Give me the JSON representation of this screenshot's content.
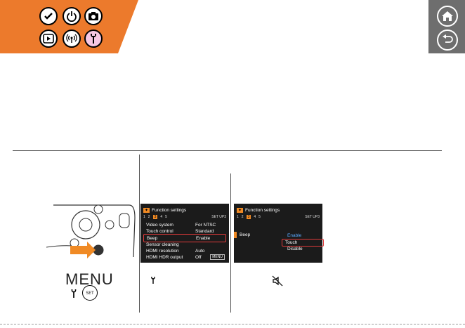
{
  "colors": {
    "accent": "#ec7a2c",
    "nav_gray": "#6e6e6e",
    "highlight_red": "#e03a3a"
  },
  "header": {
    "icons": [
      "check-icon",
      "power-icon",
      "camera-icon",
      "play-icon",
      "wireless-icon",
      "wrench-icon"
    ],
    "nav": [
      "home-icon",
      "back-icon"
    ]
  },
  "screen1": {
    "title": "Function settings",
    "tabs": [
      "1",
      "2",
      "3",
      "4",
      "5"
    ],
    "active_tab": "3",
    "right_label": "SET UP3",
    "rows": [
      {
        "label": "Video system",
        "value": "For NTSC"
      },
      {
        "label": "Touch control",
        "value": "Standard"
      },
      {
        "label": "Beep",
        "value": "Enable"
      },
      {
        "label": "Sensor cleaning",
        "value": ""
      },
      {
        "label": "HDMI resolution",
        "value": "Auto"
      },
      {
        "label": "HDMI HDR output",
        "value": "Off"
      }
    ],
    "menu_button": "MENU"
  },
  "screen2": {
    "title": "Function settings",
    "tabs": [
      "1",
      "2",
      "3",
      "4",
      "5"
    ],
    "active_tab": "3",
    "right_label": "SET UP3",
    "beep_label": "Beep",
    "options": [
      "Enable",
      "Touch",
      "Disable"
    ]
  },
  "captions": {
    "menu_word": "MENU"
  }
}
